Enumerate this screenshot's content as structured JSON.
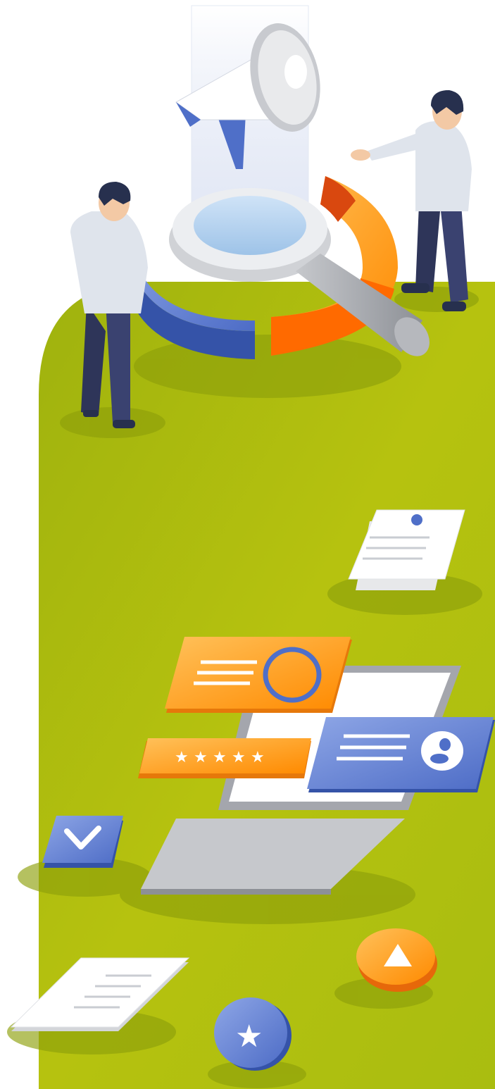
{
  "illustration": {
    "colors": {
      "background": "#ffffff",
      "green_panel": "#b3c10f",
      "green_dark": "#9aab0c",
      "orange": "#ff8a00",
      "orange_light": "#ffb347",
      "blue": "#4f6fc8",
      "blue_light": "#7f9be0",
      "gray": "#a4a6ad",
      "navy": "#2e3559",
      "shirt": "#dfe4ec"
    },
    "icons": [
      "megaphone-icon",
      "magnifier-icon",
      "donut-chart-icon",
      "laptop-icon",
      "checkmark-icon",
      "play-icon",
      "star-icon",
      "user-icon",
      "rating-stars-icon",
      "document-icon"
    ],
    "rating_stars": 5
  }
}
